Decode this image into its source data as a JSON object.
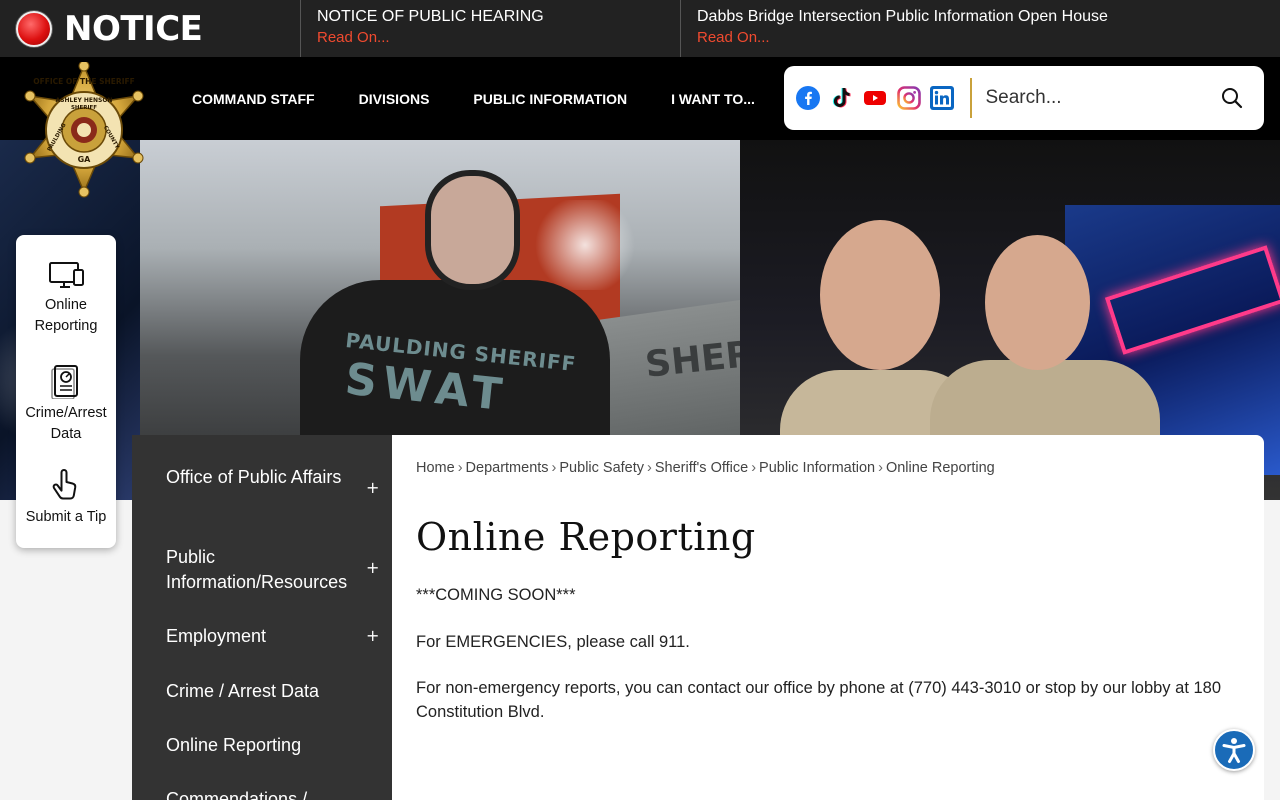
{
  "notice": {
    "label": "NOTICE",
    "items": [
      {
        "title": "NOTICE OF PUBLIC HEARING",
        "link": "Read On..."
      },
      {
        "title": "Dabbs Bridge Intersection Public Information Open House",
        "link": "Read On..."
      }
    ]
  },
  "badge": {
    "top_text": "OFFICE OF THE SHERIFF",
    "name_text": "ASHLEY HENSON",
    "title_text": "SHERIFF",
    "left_text": "PAULDING",
    "right_text": "COUNTY",
    "state_text": "GA"
  },
  "nav": {
    "items": [
      "COMMAND STAFF",
      "DIVISIONS",
      "PUBLIC INFORMATION",
      "I WANT TO..."
    ]
  },
  "social": {
    "icons": [
      "facebook-icon",
      "tiktok-icon",
      "youtube-icon",
      "instagram-icon",
      "linkedin-icon"
    ]
  },
  "search": {
    "placeholder": "Search..."
  },
  "hero": {
    "shirt_line1": "PAULDING SHERIFF",
    "shirt_line2": "SWAT",
    "truck_text": "SHERIFF"
  },
  "quick_links": [
    {
      "label": "Online Reporting",
      "icon": "computer-monitor-icon"
    },
    {
      "label": "Crime/Arrest Data",
      "icon": "report-document-icon"
    },
    {
      "label": "Submit a Tip",
      "icon": "hand-pointer-icon"
    }
  ],
  "sidebar": {
    "items": [
      {
        "label": "Office of Public Affairs",
        "expandable": true
      },
      {
        "label": "Public Information/Resources",
        "expandable": true
      },
      {
        "label": "Employment",
        "expandable": true
      },
      {
        "label": "Crime / Arrest Data",
        "expandable": false
      },
      {
        "label": "Online Reporting",
        "expandable": false
      },
      {
        "label": "Commendations /",
        "expandable": false
      }
    ],
    "plus": "+"
  },
  "breadcrumb": {
    "items": [
      "Home",
      "Departments",
      "Public Safety",
      "Sheriff's Office",
      "Public Information",
      "Online Reporting"
    ],
    "separator": "›"
  },
  "page": {
    "title": "Online Reporting",
    "paragraphs": [
      "***COMING SOON***",
      "For EMERGENCIES, please call 911.",
      "For non-emergency reports, you can contact our office by phone at (770) 443-3010 or stop by our lobby at 180 Constitution Blvd."
    ]
  },
  "colors": {
    "notice_link": "#f04a2f",
    "header_bg": "#000000",
    "sidebar_bg": "#333333",
    "accent_gold": "#c9a13b",
    "accessibility_blue": "#1a6bb8"
  }
}
